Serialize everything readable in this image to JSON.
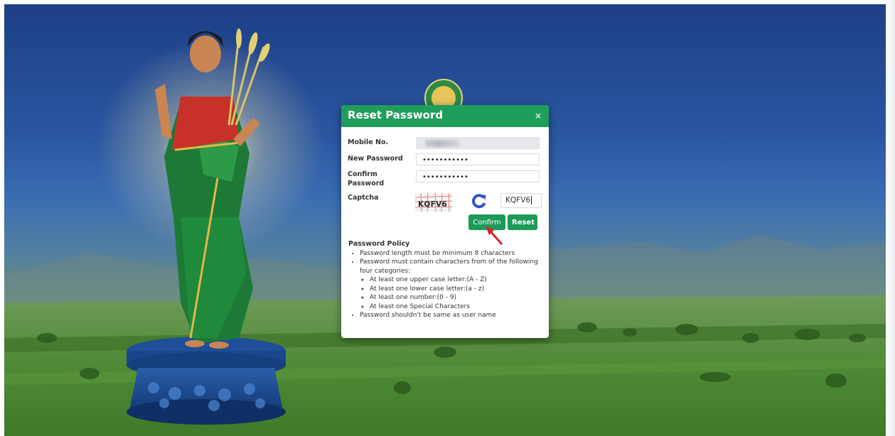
{
  "modal": {
    "title": "Reset Password",
    "close_glyph": "×",
    "fields": {
      "mobile_label": "Mobile No.",
      "new_password_label": "New Password",
      "confirm_password_label_line1": "Confirm",
      "confirm_password_label_line2": "Password",
      "captcha_label": "Captcha",
      "new_password_mask": "•••••••••••",
      "confirm_password_mask": "•••••••••••",
      "captcha_image_text": "KQFV6",
      "captcha_value": "KQFV6"
    },
    "buttons": {
      "confirm_label": "Confirm",
      "reset_label": "Reset"
    },
    "policy": {
      "title": "Password Policy",
      "rule_1": "Password length must be minimum 8 characters",
      "rule_2": "Password must contain characters from of the following four categories:",
      "sub_1": "At least one upper case letter:(A - Z)",
      "sub_2": "At least one lower case letter:(a - z)",
      "sub_3": "At least one number:(0 - 9)",
      "sub_4": "At least one Special Characters",
      "rule_3": "Password shouldn't be same as user name"
    }
  },
  "colors": {
    "header_green": "#1f9d5b",
    "button_green": "#1b9a58",
    "refresh_blue": "#2f54c9",
    "arrow_red": "#d8261f"
  },
  "icons": {
    "refresh": "refresh-icon",
    "close": "close-icon",
    "arrow": "red-arrow-icon"
  }
}
